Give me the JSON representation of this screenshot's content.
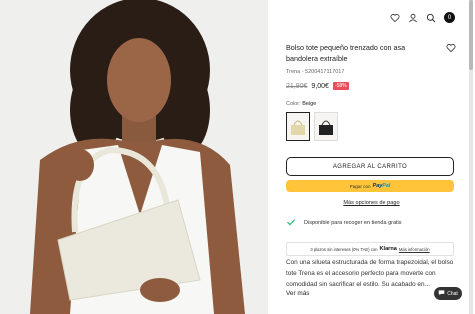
{
  "header": {
    "icons": [
      "heart-icon",
      "user-icon",
      "search-icon",
      "bag-icon"
    ],
    "cart_count": "0"
  },
  "product": {
    "title": "Bolso tote pequeño trenzado con asa bandolera extraíble",
    "ref": "Trena - 5200417117017",
    "price_old": "21,90€",
    "price_new": "9,00€",
    "discount": "-58%",
    "color_label": "Color:",
    "color_value": "Beige",
    "selected_swatch": 0
  },
  "actions": {
    "add_to_cart": "AGREGAR AL CARRITO",
    "paypal_prefix": "Pagar con",
    "paypal_brand_a": "Pay",
    "paypal_brand_b": "Pal",
    "more_payment": "Más opciones de pago"
  },
  "pickup": {
    "text": "Disponible para recoger en tienda gratis"
  },
  "klarna": {
    "text": "3 plazos sin intereses (0% TAE) con",
    "brand": "Klarna",
    "link": "Más información"
  },
  "description": {
    "text": "Con una silueta estructurada de forma trapezoidal, el bolso tote Trena es el accesorio perfecto para moverte con comodidad sin sacrificar el estilo. Su acabado en...",
    "more": "Ver más"
  },
  "chat": {
    "label": "Chat"
  },
  "colors": {
    "accent": "#222222",
    "paypal_yellow": "#ffc439",
    "discount_red": "#e94c5a",
    "check_green": "#2bb673"
  }
}
